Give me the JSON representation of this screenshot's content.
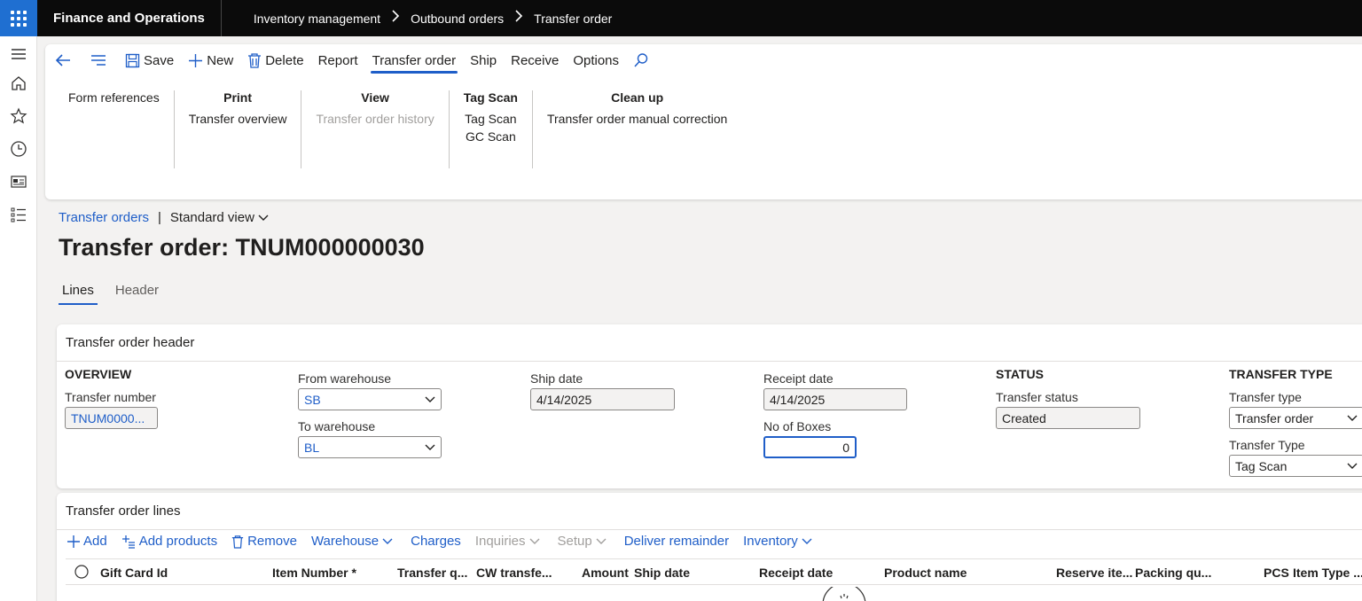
{
  "topbar": {
    "app_title": "Finance and Operations",
    "breadcrumbs": [
      "Inventory management",
      "Outbound orders",
      "Transfer order"
    ]
  },
  "action_pane": {
    "buttons": {
      "save": "Save",
      "new": "New",
      "delete": "Delete",
      "report": "Report"
    },
    "tabs": [
      "Transfer order",
      "Ship",
      "Receive",
      "Options"
    ],
    "groups": {
      "form_references": "Form references",
      "print": {
        "title": "Print",
        "items": [
          "Transfer overview"
        ]
      },
      "view": {
        "title": "View",
        "items": [
          "Transfer order history"
        ]
      },
      "tag_scan": {
        "title": "Tag Scan",
        "items": [
          "Tag Scan",
          "GC Scan"
        ]
      },
      "clean_up": {
        "title": "Clean up",
        "items": [
          "Transfer order manual correction"
        ]
      }
    }
  },
  "page": {
    "list_link": "Transfer orders",
    "view_name": "Standard view",
    "title": "Transfer order: TNUM000000030",
    "tabs": [
      "Lines",
      "Header"
    ]
  },
  "header_card": {
    "title": "Transfer order header",
    "overview": {
      "section": "OVERVIEW",
      "transfer_number_label": "Transfer number",
      "transfer_number_value": "TNUM0000..."
    },
    "from_warehouse": {
      "label": "From warehouse",
      "value": "SB"
    },
    "to_warehouse": {
      "label": "To warehouse",
      "value": "BL"
    },
    "ship_date": {
      "label": "Ship date",
      "value": "4/14/2025"
    },
    "receipt_date": {
      "label": "Receipt date",
      "value": "4/14/2025"
    },
    "no_of_boxes": {
      "label": "No of Boxes",
      "value": "0"
    },
    "status": {
      "section": "STATUS",
      "label": "Transfer status",
      "value": "Created"
    },
    "transfer_type": {
      "section": "TRANSFER TYPE",
      "label1": "Transfer type",
      "value1": "Transfer order",
      "label2": "Transfer Type",
      "value2": "Tag Scan"
    }
  },
  "lines_card": {
    "title": "Transfer order lines",
    "toolbar": {
      "add": "Add",
      "add_products": "Add products",
      "remove": "Remove",
      "warehouse": "Warehouse",
      "charges": "Charges",
      "inquiries": "Inquiries",
      "setup": "Setup",
      "deliver_remainder": "Deliver remainder",
      "inventory": "Inventory"
    },
    "columns": [
      "Gift Card Id",
      "Item Number *",
      "Transfer q...",
      "CW transfe...",
      "Amount",
      "Ship date",
      "Receipt date",
      "Product name",
      "Reserve ite...",
      "Packing qu...",
      "PCS",
      "Item Type ..."
    ]
  },
  "colors": {
    "accent": "#1f5ec8",
    "topbar": "#0b0b0b",
    "waffle": "#1f6fd1"
  }
}
